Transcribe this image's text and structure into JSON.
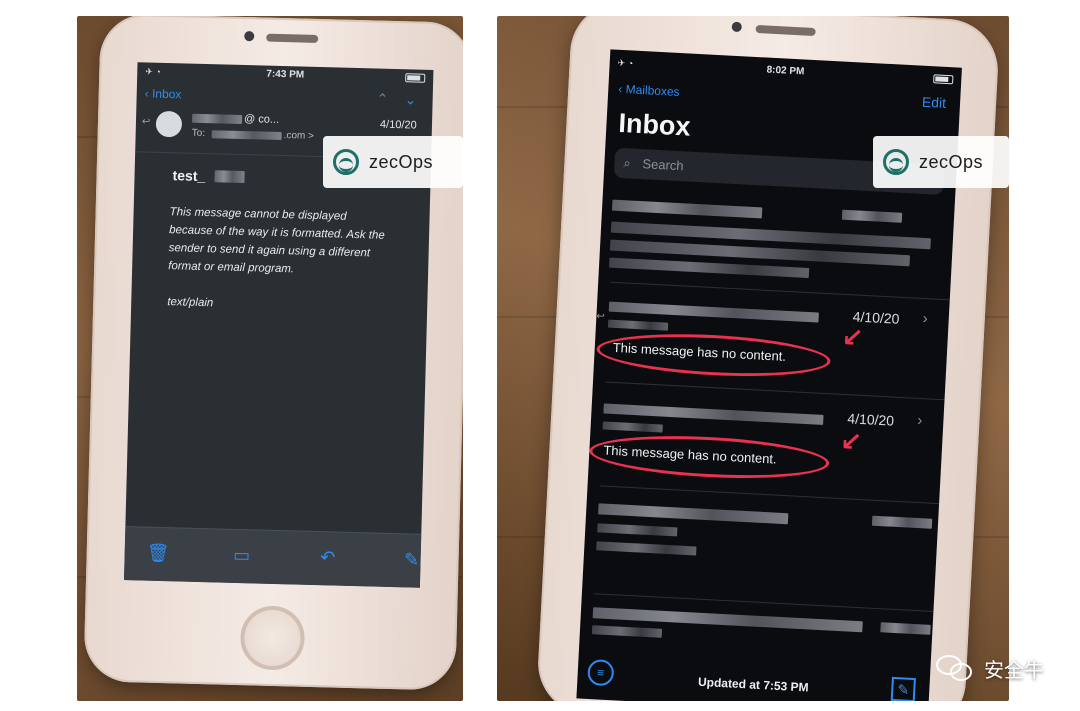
{
  "left_photo": {
    "status_time": "7:43 PM",
    "back_label": "Inbox",
    "header": {
      "sender": "@ co...",
      "to_prefix": "To:",
      "to_domain": ".com >",
      "date": "4/10/20"
    },
    "subject": "test_",
    "body_lines": [
      "This message cannot be displayed",
      "because of the way it is formatted. Ask the",
      "sender to send it again using a different",
      "format or email program."
    ],
    "content_type": "text/plain",
    "toolbar_icons": [
      "trash-icon",
      "folder-icon",
      "reply-icon",
      "compose-icon"
    ]
  },
  "right_photo": {
    "status_time": "8:02 PM",
    "back_label": "Mailboxes",
    "edit_label": "Edit",
    "title": "Inbox",
    "search_placeholder": "Search",
    "rows": [
      {
        "date": "4/10/20",
        "preview": "This message has no content."
      },
      {
        "date": "4/10/20",
        "preview": "This message has no content."
      }
    ],
    "updated_status": "Updated at 7:53 PM",
    "highlight_color": "#e8324f"
  },
  "watermark": {
    "brand": "zecOps",
    "wechat_account": "安全牛"
  },
  "colors": {
    "ios_blue": "#2e8cf0",
    "annotation_red": "#e8324f",
    "zecops_teal": "#1f6f68"
  }
}
